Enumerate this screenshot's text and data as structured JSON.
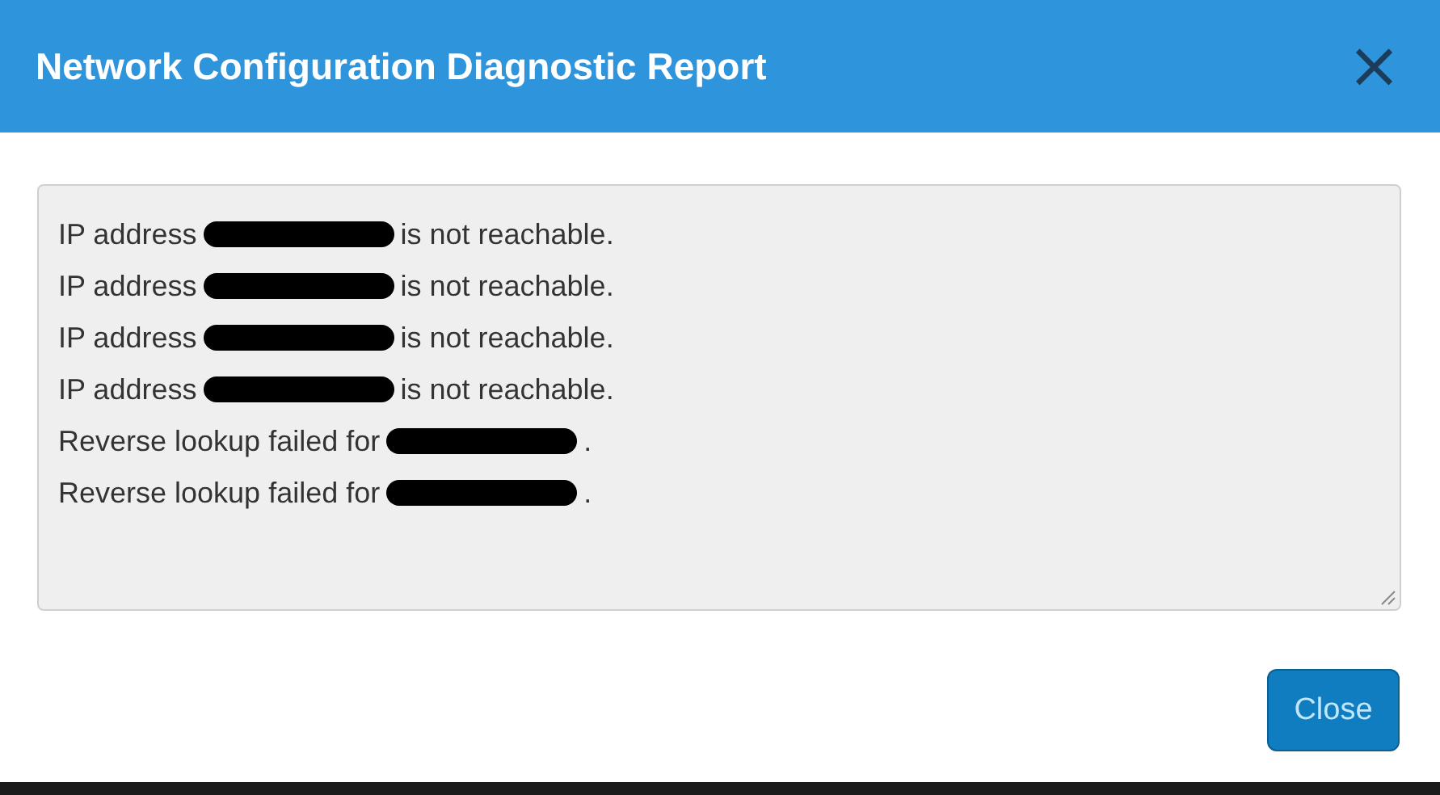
{
  "dialog": {
    "title": "Network Configuration Diagnostic Report",
    "close_icon": "×",
    "report_lines": [
      {
        "before": "IP address",
        "after": "is not reachable."
      },
      {
        "before": "IP address",
        "after": "is not reachable."
      },
      {
        "before": "IP address",
        "after": "is not reachable."
      },
      {
        "before": "IP address",
        "after": "is not reachable."
      },
      {
        "before": "Reverse lookup failed for",
        "after": "."
      },
      {
        "before": "Reverse lookup failed for",
        "after": "."
      }
    ],
    "buttons": [
      "Close"
    ]
  }
}
